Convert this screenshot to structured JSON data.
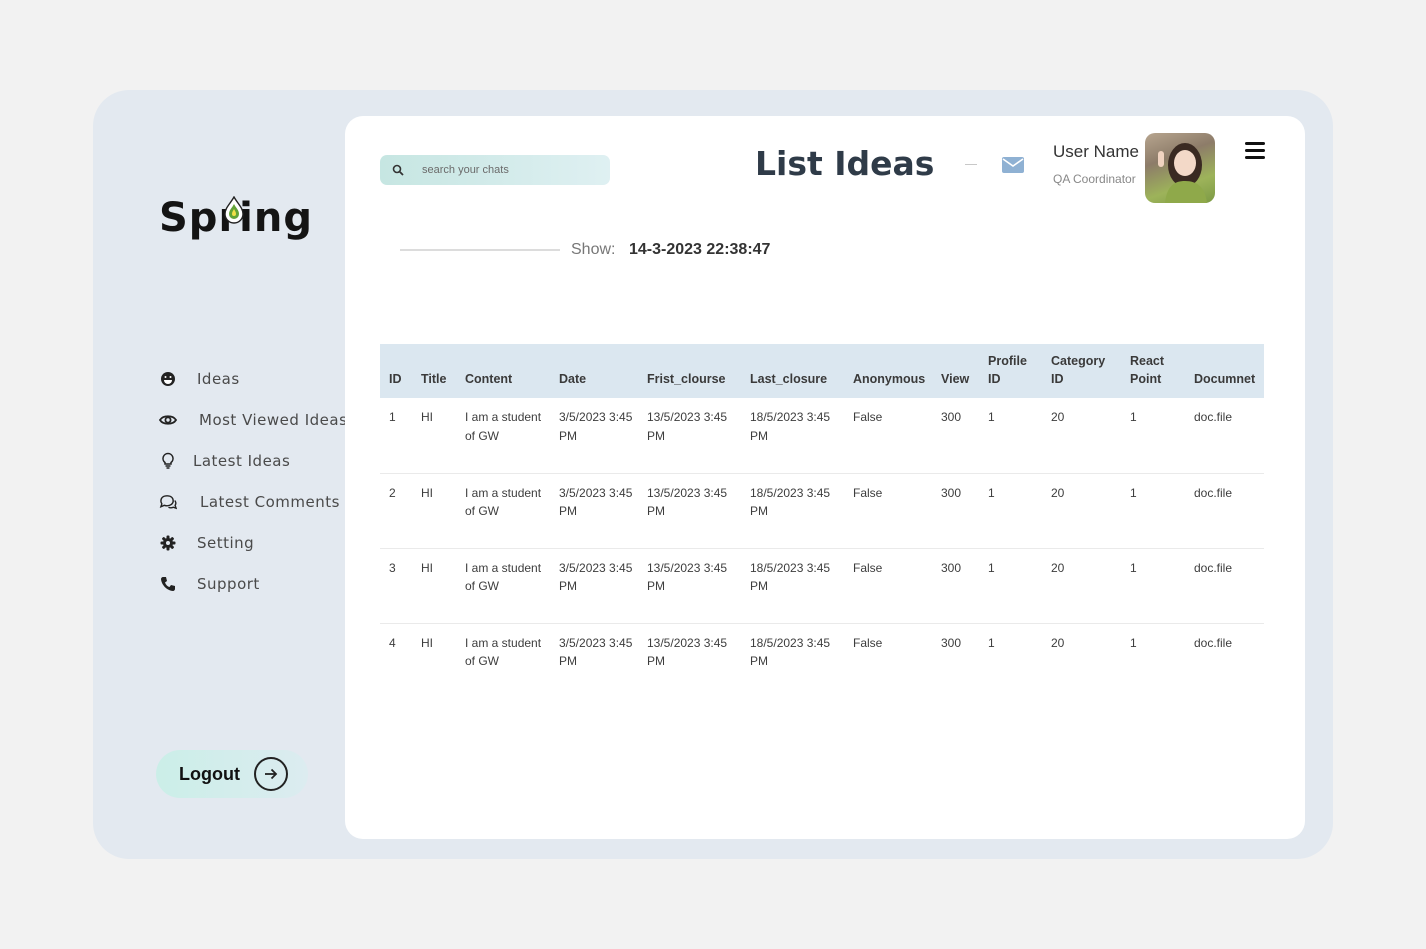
{
  "brand": {
    "name": "Spring"
  },
  "sidebar": {
    "items": [
      {
        "label": "Ideas",
        "icon": "smile-icon"
      },
      {
        "label": "Most Viewed Ideas",
        "icon": "eye-icon"
      },
      {
        "label": "Latest Ideas",
        "icon": "lightbulb-icon"
      },
      {
        "label": "Latest Comments",
        "icon": "comments-icon"
      },
      {
        "label": "Setting",
        "icon": "gear-icon"
      },
      {
        "label": "Support",
        "icon": "phone-icon"
      }
    ],
    "logout_label": "Logout"
  },
  "header": {
    "search_placeholder": "search your chats",
    "title": "List Ideas",
    "user_name": "User Name",
    "user_role": "QA Coordinator"
  },
  "show": {
    "label": "Show:",
    "value": "14-3-2023 22:38:47"
  },
  "table": {
    "columns": [
      "ID",
      "Title",
      "Content",
      "Date",
      "Frist_clourse",
      "Last_closure",
      "Anonymous",
      "View",
      "Profile ID",
      "Category ID",
      "React Point",
      "Documnet"
    ],
    "rows": [
      [
        "1",
        "HI",
        "I am a student of GW",
        "3/5/2023 3:45 PM",
        "13/5/2023 3:45 PM",
        "18/5/2023 3:45 PM",
        "False",
        "300",
        "1",
        "20",
        "1",
        "doc.file"
      ],
      [
        "2",
        "HI",
        "I am a student of GW",
        "3/5/2023 3:45 PM",
        "13/5/2023 3:45 PM",
        "18/5/2023 3:45 PM",
        "False",
        "300",
        "1",
        "20",
        "1",
        "doc.file"
      ],
      [
        "3",
        "HI",
        "I am a student of GW",
        "3/5/2023 3:45 PM",
        "13/5/2023 3:45 PM",
        "18/5/2023 3:45 PM",
        "False",
        "300",
        "1",
        "20",
        "1",
        "doc.file"
      ],
      [
        "4",
        "HI",
        "I am a student of GW",
        "3/5/2023 3:45 PM",
        "13/5/2023 3:45 PM",
        "18/5/2023 3:45 PM",
        "False",
        "300",
        "1",
        "20",
        "1",
        "doc.file"
      ]
    ]
  },
  "colors": {
    "accent": "#2f3b48",
    "panel_bg": "#e3e9f0",
    "header_row": "#dbe7f0",
    "mail_icon": "#8fb1d3"
  }
}
